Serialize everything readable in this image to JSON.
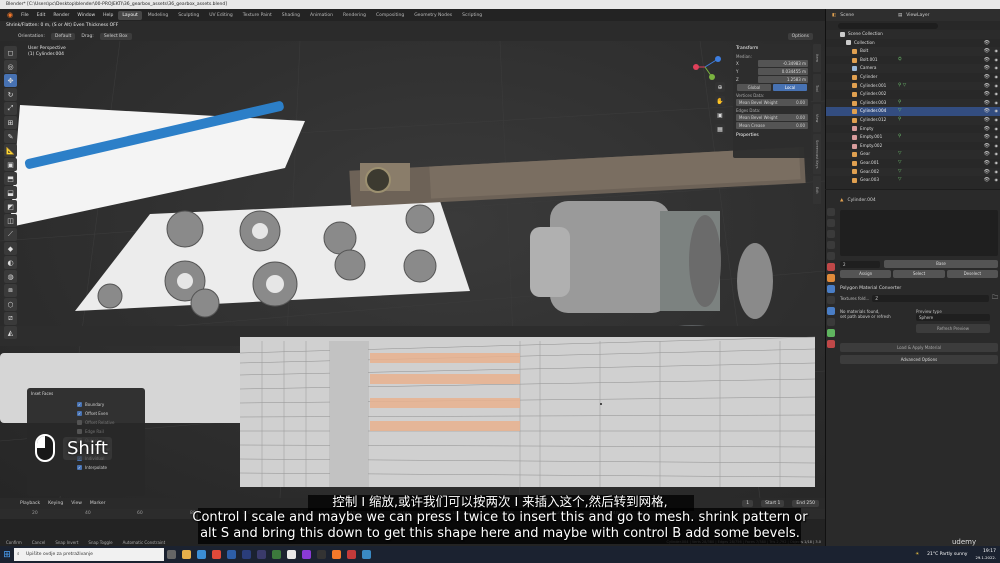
{
  "window": {
    "title": "Blender* [C:\\Users\\pc\\Desktop\\blender\\00-PROJEKTI\\36_gearbox_assets\\36_gearbox_assets.blend]"
  },
  "menu": {
    "items": [
      "File",
      "Edit",
      "Render",
      "Window",
      "Help"
    ],
    "workspaces": [
      "Layout",
      "Modeling",
      "Sculpting",
      "UV Editing",
      "Texture Paint",
      "Shading",
      "Animation",
      "Rendering",
      "Compositing",
      "Geometry Nodes",
      "Scripting"
    ],
    "active_workspace": "Layout"
  },
  "tool_header": {
    "operator_hint": "Shrink/Flatten: 0 m, (S or Alt) Even Thickness OFF",
    "orientation_label": "Orientation:",
    "orientation_value": "Default",
    "drag_label": "Drag:",
    "drag_value": "Select Box",
    "options_label": "Options"
  },
  "viewport": {
    "view_name": "User Perspective",
    "object_name": "(1) Cylinder.004"
  },
  "n_panel": {
    "transform_header": "Transform",
    "median_label": "Median:",
    "x_label": "X",
    "x_value": "-0.34983 m",
    "y_label": "Y",
    "y_value": "0.034455 m",
    "z_label": "Z",
    "z_value": "1.2583 m",
    "global_label": "Global",
    "local_label": "Local",
    "vertices_data": "Vertices Data:",
    "mean_bevel_weight": "Mean Bevel Weight",
    "bevel_weight_value": "0.00",
    "edges_data": "Edges Data:",
    "edge_bevel_label": "Mean Bevel Weight",
    "edge_bevel_value": "0.00",
    "mean_crease": "Mean Crease",
    "mean_crease_value": "0.00",
    "properties_header": "Properties"
  },
  "side_tabs": [
    "Item",
    "Tool",
    "View",
    "Screencast Keys",
    "Edit"
  ],
  "operator_panel": {
    "title": "Inset Faces",
    "checkboxes": [
      {
        "label": "Boundary",
        "checked": true
      },
      {
        "label": "Offset Even",
        "checked": true
      },
      {
        "label": "Offset Relative",
        "checked": false
      },
      {
        "label": "Edge Rail",
        "checked": false
      },
      {
        "label": "Outset",
        "checked": false
      },
      {
        "label": "Select Outer",
        "checked": false
      },
      {
        "label": "Individual",
        "checked": true
      },
      {
        "label": "Interpolate",
        "checked": true
      }
    ]
  },
  "keycast": {
    "key": "Shift"
  },
  "timeline": {
    "playback": "Playback",
    "keying": "Keying",
    "view": "View",
    "marker": "Marker",
    "current_frame": "1",
    "start_label": "Start",
    "start_value": "1",
    "end_label": "End",
    "end_value": "250",
    "ruler_ticks": [
      "20",
      "40",
      "60",
      "80",
      "100",
      "120",
      "140",
      "160",
      "180",
      "200",
      "220",
      "240"
    ]
  },
  "statusbar": {
    "confirm": "Confirm",
    "cancel": "Cancel",
    "snap_invert": "Snap Invert",
    "snap_toggle": "Snap Toggle",
    "auto_constraint": "Automatic Constraint",
    "stats": "Cylinder.004 | Verts 28/380 | Edges 28/756 | Faces 7/380 | Tris 2,792 | Objects 1/18 | 3.0"
  },
  "outliner": {
    "scene_label": "Scene",
    "view_layer_label": "ViewLayer",
    "root": "Scene Collection",
    "collection": "Collection",
    "items": [
      {
        "name": "Bolt",
        "selected": false
      },
      {
        "name": "Bolt.001",
        "selected": false
      },
      {
        "name": "Camera",
        "selected": false
      },
      {
        "name": "Cylinder",
        "selected": false
      },
      {
        "name": "Cylinder.001",
        "selected": false
      },
      {
        "name": "Cylinder.002",
        "selected": false
      },
      {
        "name": "Cylinder.003",
        "selected": false
      },
      {
        "name": "Cylinder.004",
        "selected": true
      },
      {
        "name": "Cylinder.012",
        "selected": false
      },
      {
        "name": "Empty",
        "selected": false
      },
      {
        "name": "Empty.001",
        "selected": false
      },
      {
        "name": "Empty.002",
        "selected": false
      },
      {
        "name": "Gear",
        "selected": false
      },
      {
        "name": "Gear.001",
        "selected": false
      },
      {
        "name": "Gear.002",
        "selected": false
      },
      {
        "name": "Gear.003",
        "selected": false
      }
    ]
  },
  "properties": {
    "object_name": "Cylinder.004",
    "slot_value": "2",
    "remove_label": "Base",
    "assign": "Assign",
    "select": "Select",
    "deselect": "Deselect",
    "converter_header": "Polygon Material Converter",
    "textures_label": "Textures fold...",
    "no_materials": "No materials found,",
    "set_path": "set path above or refresh",
    "preview_type_label": "Preview type",
    "preview_type_value": "Sphere",
    "preview_btn": "Refresh Preview",
    "load_apply": "Load & Apply Material",
    "advanced": "Advanced Options"
  },
  "taskbar": {
    "search_placeholder": "Upišite ovdje za pretraživanje",
    "weather": "21°C  Partly sunny",
    "time": "19:17",
    "date": "29.1.2022."
  },
  "subtitles": {
    "chinese": "控制 I 缩放,或许我们可以按两次 I 来插入这个,然后转到网格,",
    "english_line1": "Control I scale and maybe we can press I twice to insert this and go to mesh. shrink pattern or",
    "english_line2": "alt S and bring this down to get this shape here and maybe with control B add some bevels."
  },
  "watermark": "udemy"
}
